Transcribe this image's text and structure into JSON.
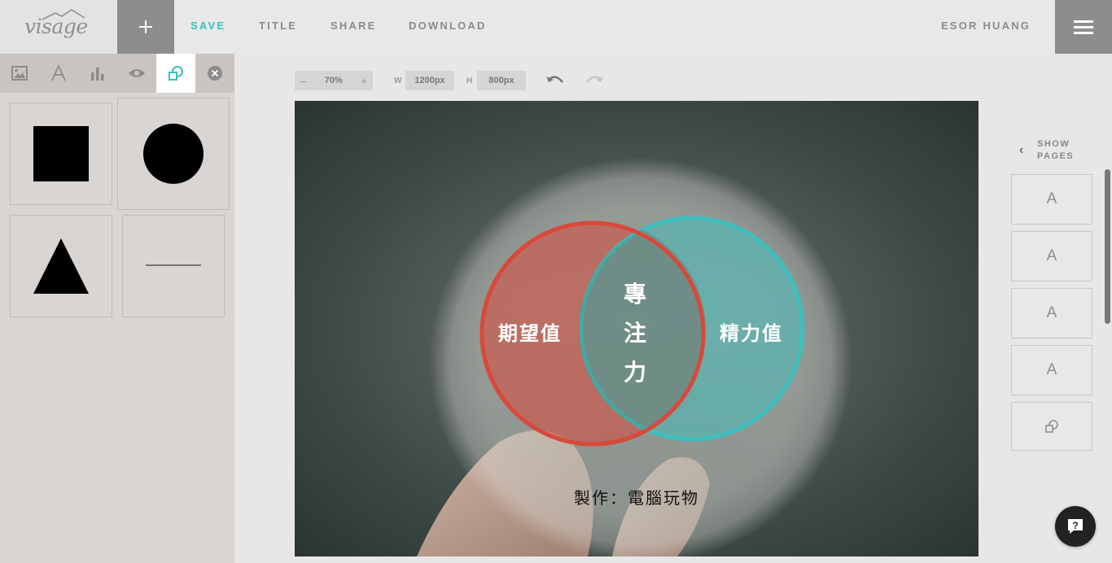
{
  "app": {
    "logo_text": "visage",
    "nav": {
      "save": "SAVE",
      "title": "TITLE",
      "share": "SHARE",
      "download": "DOWNLOAD"
    },
    "user_name": "ESOR HUANG",
    "accent_color": "#37c3c0"
  },
  "left_panel": {
    "tools": [
      "image-icon",
      "text-icon",
      "chart-icon",
      "eye-icon",
      "shapes-icon",
      "close-icon"
    ],
    "active_tool": "shapes-icon",
    "shapes": [
      "square",
      "circle",
      "triangle",
      "line"
    ]
  },
  "canvas_controls": {
    "zoom_minus": "–",
    "zoom": "70%",
    "zoom_plus": "+",
    "width_label": "W",
    "width_value": "1200px",
    "height_label": "H",
    "height_value": "800px"
  },
  "canvas": {
    "left_circle_label": "期望值",
    "center_label_1": "專",
    "center_label_2": "注",
    "center_label_3": "力",
    "right_circle_label": "精力值",
    "credit": "製作：電腦玩物",
    "left_circle_color": "#d8493a",
    "right_circle_color": "#3dbfbd"
  },
  "pages_panel": {
    "show_pages_line1": "SHOW",
    "show_pages_line2": "PAGES",
    "pages": [
      "A",
      "A",
      "A",
      "A"
    ],
    "last_page_icon": "shapes-icon"
  },
  "help": {
    "label": "?"
  }
}
